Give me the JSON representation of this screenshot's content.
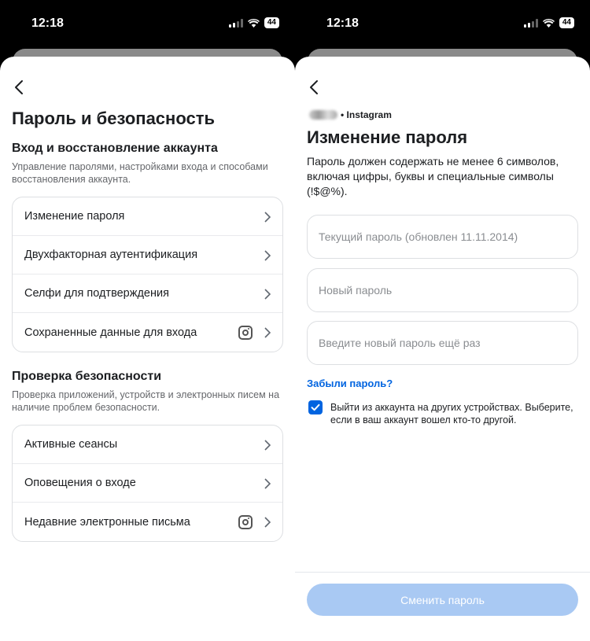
{
  "status_bar": {
    "time": "12:18",
    "battery": "44"
  },
  "left": {
    "title": "Пароль и безопасность",
    "section1": {
      "title": "Вход и восстановление аккаунта",
      "description": "Управление паролями, настройками входа и способами восстановления аккаунта.",
      "items": [
        {
          "label": "Изменение пароля",
          "icon": "chevron-right"
        },
        {
          "label": "Двухфакторная аутентификация",
          "icon": "chevron-right"
        },
        {
          "label": "Селфи для подтверждения",
          "icon": "chevron-right"
        },
        {
          "label": "Сохраненные данные для входа",
          "icon": "instagram"
        }
      ]
    },
    "section2": {
      "title": "Проверка безопасности",
      "description": "Проверка приложений, устройств и электронных писем на наличие проблем безопасности.",
      "items": [
        {
          "label": "Активные сеансы",
          "icon": "chevron-right"
        },
        {
          "label": "Оповещения о входе",
          "icon": "chevron-right"
        },
        {
          "label": "Недавние электронные письма",
          "icon": "instagram"
        }
      ]
    }
  },
  "right": {
    "account_suffix": "• Instagram",
    "title": "Изменение пароля",
    "description": "Пароль должен содержать не менее 6 символов, включая цифры, буквы и специальные символы (!$@%).",
    "fields": {
      "current_placeholder": "Текущий пароль (обновлен 11.11.2014)",
      "new_placeholder": "Новый пароль",
      "repeat_placeholder": "Введите новый пароль ещё раз"
    },
    "forgot_link": "Забыли пароль?",
    "logout_checkbox": {
      "checked": true,
      "label": "Выйти из аккаунта на других устройствах. Выберите, если в ваш аккаунт вошел кто-то другой."
    },
    "submit_label": "Сменить пароль"
  },
  "colors": {
    "accent": "#0064e0",
    "button_disabled": "#a9c9f3",
    "text_secondary": "#65676b"
  }
}
